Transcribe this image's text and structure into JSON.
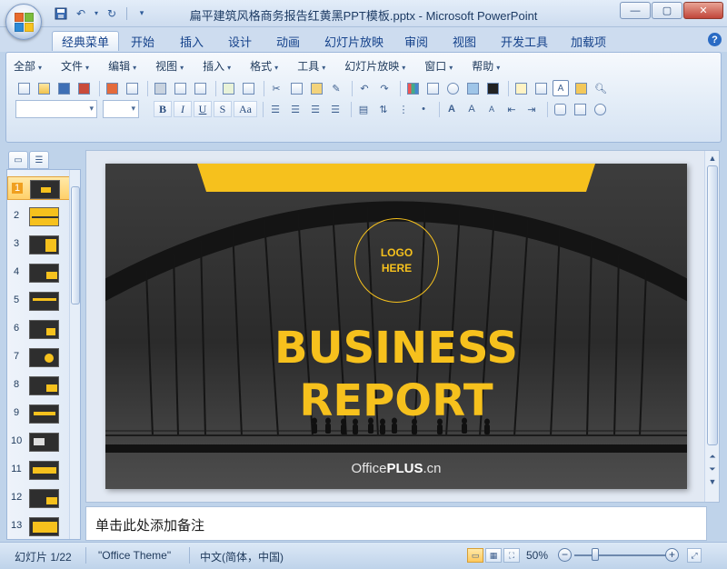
{
  "window": {
    "title": "扁平建筑风格商务报告红黄黑PPT模板.pptx - Microsoft PowerPoint",
    "buttons": {
      "minimize": "—",
      "maximize": "▢",
      "close": "✕"
    }
  },
  "quick_access": {
    "icons": [
      "save-icon",
      "undo-icon",
      "redo-icon",
      "customize-icon"
    ]
  },
  "tabs": [
    {
      "label": "经典菜单",
      "active": true
    },
    {
      "label": "开始"
    },
    {
      "label": "插入"
    },
    {
      "label": "设计"
    },
    {
      "label": "动画"
    },
    {
      "label": "幻灯片放映"
    },
    {
      "label": "审阅"
    },
    {
      "label": "视图"
    },
    {
      "label": "开发工具"
    },
    {
      "label": "加载项"
    }
  ],
  "menus": [
    "全部",
    "文件",
    "编辑",
    "视图",
    "插入",
    "格式",
    "工具",
    "幻灯片放映",
    "窗口",
    "帮助"
  ],
  "format_buttons": [
    "B",
    "I",
    "U",
    "S",
    "Aa"
  ],
  "slide_panel": {
    "slides": [
      "1",
      "2",
      "3",
      "4",
      "5",
      "6",
      "7",
      "8",
      "9",
      "10",
      "11",
      "12",
      "13"
    ],
    "selected": "1"
  },
  "slide": {
    "logo_line1": "LOGO",
    "logo_line2": "HERE",
    "title_line1": "BUSINESS",
    "title_line2": "REPORT",
    "brand_prefix": "Office",
    "brand_strong": "PLUS",
    "brand_suffix": ".cn",
    "accent_color": "#f6c11d"
  },
  "notes": {
    "placeholder": "单击此处添加备注"
  },
  "status": {
    "slide_info": "幻灯片 1/22",
    "theme": "\"Office Theme\"",
    "language": "中文(简体，中国)",
    "zoom": "50%"
  }
}
